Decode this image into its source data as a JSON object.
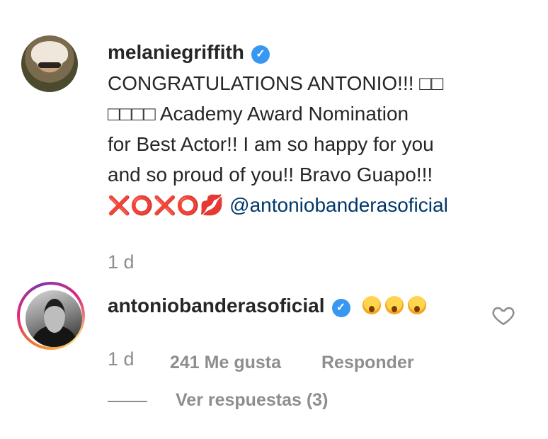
{
  "comment1": {
    "username": "melaniegriffith",
    "text_line1": "CONGRATULATIONS ANTONIO!!! □□",
    "text_line2": "□□□□ Academy Award Nomination",
    "text_line3": "for Best Actor!! I am so happy for you",
    "text_line4": "and so proud of you!! Bravo Guapo!!!",
    "xoxo": "❌⭕❌⭕",
    "kiss": "💋",
    "mention": "@antoniobanderasoficial",
    "time": "1 d"
  },
  "comment2": {
    "username": "antoniobanderasoficial",
    "time": "1 d",
    "likes": "241 Me gusta",
    "reply": "Responder",
    "view_replies": "Ver respuestas (3)"
  },
  "icons": {
    "verified": "verified-badge-icon",
    "heart": "heart-outline-icon"
  }
}
